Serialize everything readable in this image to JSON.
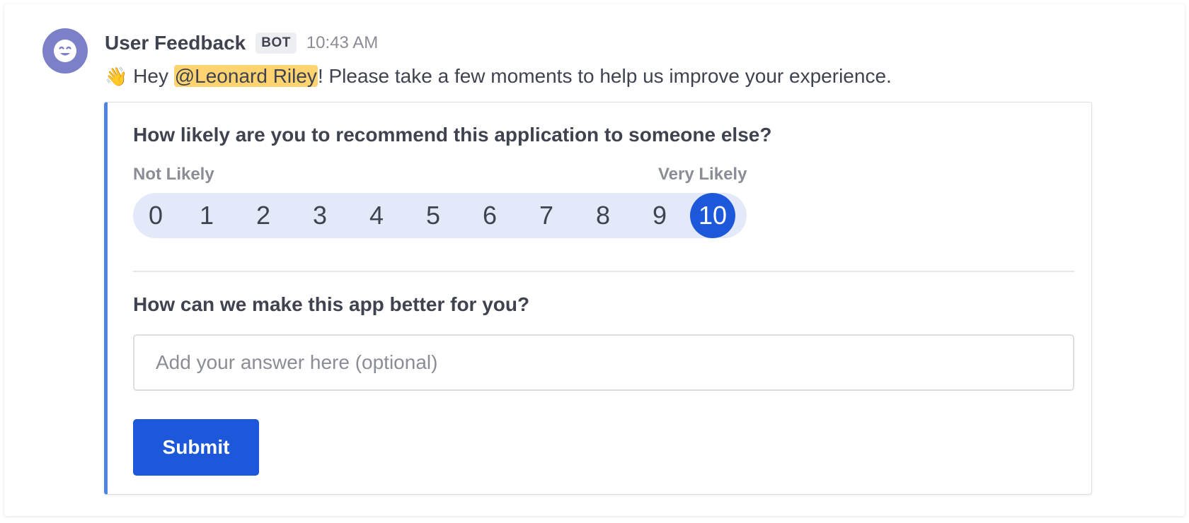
{
  "post": {
    "author": "User Feedback",
    "tag": "BOT",
    "timestamp": "10:43 AM",
    "avatar_icon": "smiling-face-icon",
    "avatar_color": "#7b80c9"
  },
  "message": {
    "emoji": "👋",
    "prefix": " Hey ",
    "mention": "@Leonard Riley",
    "suffix": "! Please take a few moments to help us improve your experience."
  },
  "survey": {
    "question_1": "How likely are you to recommend this application to someone else?",
    "scale_low_label": "Not Likely",
    "scale_high_label": "Very Likely",
    "scores": [
      "0",
      "1",
      "2",
      "3",
      "4",
      "5",
      "6",
      "7",
      "8",
      "9",
      "10"
    ],
    "selected_score": "10",
    "question_2": "How can we make this app better for you?",
    "answer_value": "",
    "answer_placeholder": "Add your answer here (optional)",
    "submit_label": "Submit"
  },
  "colors": {
    "accent": "#1c58d9",
    "card_border_accent": "#4f84e3",
    "mention_highlight": "#ffd470",
    "scale_background": "#e3e9f8"
  }
}
